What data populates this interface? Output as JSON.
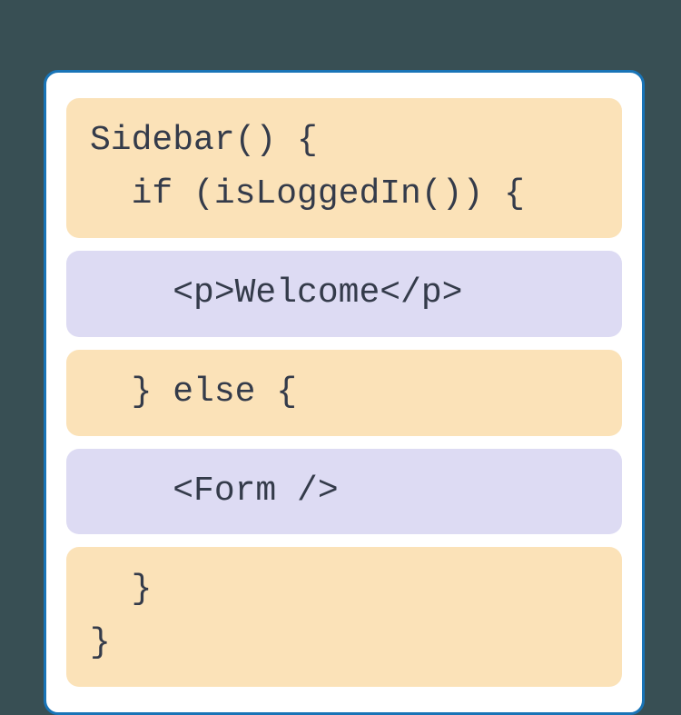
{
  "code": {
    "blocks": [
      {
        "kind": "js",
        "text": "Sidebar() {\n  if (isLoggedIn()) {"
      },
      {
        "kind": "jsx",
        "text": "    <p>Welcome</p>"
      },
      {
        "kind": "js",
        "text": "  } else {"
      },
      {
        "kind": "jsx",
        "text": "    <Form />"
      },
      {
        "kind": "js",
        "text": "  }\n}"
      }
    ]
  },
  "colors": {
    "background": "#384f54",
    "card_bg": "#ffffff",
    "card_border": "#1974b7",
    "js_block": "#fbe2b8",
    "jsx_block": "#dddbf3",
    "text": "#343b4a"
  }
}
